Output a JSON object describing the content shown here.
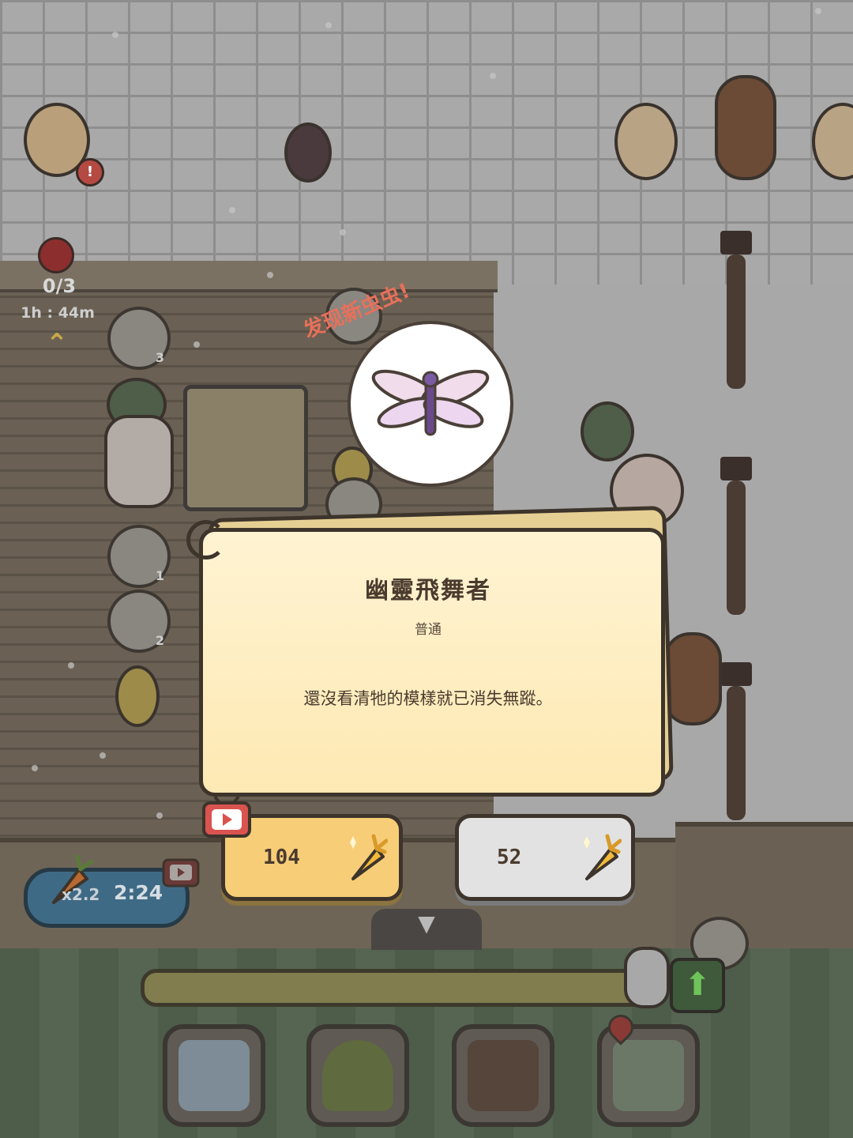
{
  "hud": {
    "task_progress": "0/3",
    "task_timer": "1h : 44m"
  },
  "discovery": {
    "banner": "发现新虫虫!",
    "bug_icon": "dragonfly-icon"
  },
  "bug_card": {
    "name": "幽靈飛舞者",
    "rarity": "普通",
    "description": "還沒看清牠的模樣就已消失無蹤。"
  },
  "buttons": {
    "ad_price": "104",
    "pay_price": "52",
    "currency_icon": "golden-carrot-icon",
    "ad_icon": "video-ad-icon"
  },
  "boost": {
    "multiplier": "x2.2",
    "time": "2:24"
  },
  "bottom_nav": {
    "items": [
      "recipe-cards-icon",
      "tree-house-icon",
      "bag-icon",
      "map-icon"
    ]
  },
  "colors": {
    "card_bg": "#fdebb8",
    "ad_button": "#f7cd78",
    "pay_button": "#e2e2e2",
    "discover_text": "#e8705a",
    "boost_bg": "#3f6a85"
  }
}
